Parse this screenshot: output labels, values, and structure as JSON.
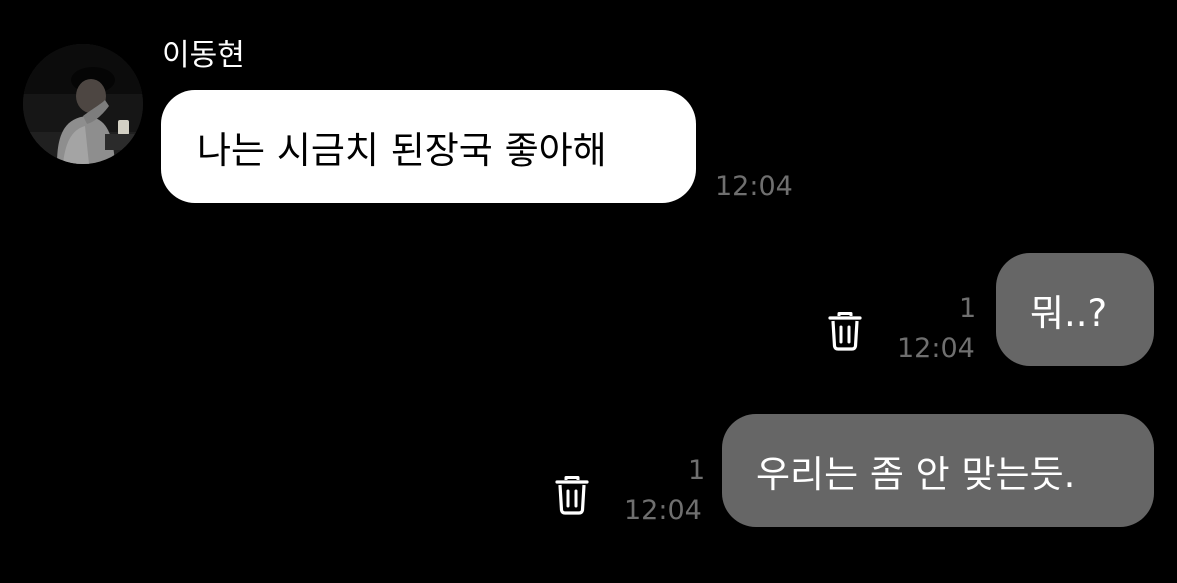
{
  "chat": {
    "sender": {
      "name": "이동현",
      "avatar_icon": "profile-photo"
    },
    "messages": [
      {
        "direction": "incoming",
        "text": "나는 시금치 된장국 좋아해",
        "time": "12:04",
        "bubble_color": "#ffffff",
        "text_color": "#000000"
      },
      {
        "direction": "outgoing",
        "text": "뭐..?",
        "time": "12:04",
        "unread_count": "1",
        "delete_icon": "trash-icon",
        "bubble_color": "#666666",
        "text_color": "#ffffff"
      },
      {
        "direction": "outgoing",
        "text": "우리는 좀 안 맞는듯.",
        "time": "12:04",
        "unread_count": "1",
        "delete_icon": "trash-icon",
        "bubble_color": "#666666",
        "text_color": "#ffffff"
      }
    ]
  },
  "colors": {
    "background": "#000000",
    "timestamp": "#6f6f6f"
  }
}
